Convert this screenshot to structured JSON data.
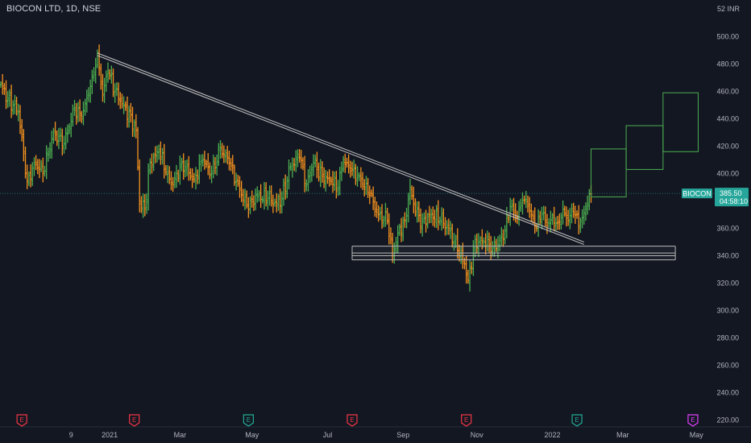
{
  "header": {
    "title": "BIOCON LTD, 1D, NSE",
    "currency": "52 INR"
  },
  "chart_data": {
    "type": "candlestick",
    "symbol": "BIOCON",
    "last_price": "385.50",
    "countdown": "04:58:10",
    "ylim": [
      210,
      530
    ],
    "y_ticks": [
      220,
      240,
      260,
      280,
      300,
      320,
      340,
      360,
      380,
      400,
      420,
      440,
      460,
      480,
      500
    ],
    "x_ticks": [
      {
        "label": "9",
        "idx": 40
      },
      {
        "label": "2021",
        "idx": 62
      },
      {
        "label": "Mar",
        "idx": 102
      },
      {
        "label": "May",
        "idx": 143
      },
      {
        "label": "Jul",
        "idx": 186
      },
      {
        "label": "Sep",
        "idx": 229
      },
      {
        "label": "Nov",
        "idx": 271
      },
      {
        "label": "2022",
        "idx": 314
      },
      {
        "label": "Mar",
        "idx": 354
      },
      {
        "label": "May",
        "idx": 396
      }
    ],
    "earnings_events": [
      {
        "label": "E",
        "idx": 12,
        "color": "#f23645"
      },
      {
        "label": "E",
        "idx": 76,
        "color": "#f23645"
      },
      {
        "label": "E",
        "idx": 141,
        "color": "#22ab94"
      },
      {
        "label": "E",
        "idx": 200,
        "color": "#f23645"
      },
      {
        "label": "E",
        "idx": 265,
        "color": "#f23645"
      },
      {
        "label": "E",
        "idx": 328,
        "color": "#22ab94"
      },
      {
        "label": "E",
        "idx": 394,
        "color": "#e040fb"
      }
    ],
    "anchors": [
      [
        0,
        465
      ],
      [
        4,
        455
      ],
      [
        10,
        445
      ],
      [
        15,
        395
      ],
      [
        20,
        408
      ],
      [
        24,
        400
      ],
      [
        30,
        430
      ],
      [
        36,
        422
      ],
      [
        42,
        448
      ],
      [
        46,
        440
      ],
      [
        52,
        470
      ],
      [
        55,
        488
      ],
      [
        58,
        458
      ],
      [
        61,
        475
      ],
      [
        65,
        460
      ],
      [
        70,
        450
      ],
      [
        77,
        432
      ],
      [
        79,
        378
      ],
      [
        82,
        374
      ],
      [
        85,
        408
      ],
      [
        90,
        416
      ],
      [
        95,
        400
      ],
      [
        98,
        392
      ],
      [
        103,
        408
      ],
      [
        110,
        396
      ],
      [
        115,
        410
      ],
      [
        120,
        400
      ],
      [
        125,
        418
      ],
      [
        130,
        408
      ],
      [
        136,
        388
      ],
      [
        141,
        374
      ],
      [
        145,
        384
      ],
      [
        152,
        382
      ],
      [
        157,
        378
      ],
      [
        160,
        382
      ],
      [
        165,
        405
      ],
      [
        170,
        412
      ],
      [
        174,
        392
      ],
      [
        178,
        408
      ],
      [
        183,
        398
      ],
      [
        188,
        394
      ],
      [
        192,
        390
      ],
      [
        195,
        410
      ],
      [
        199,
        402
      ],
      [
        204,
        398
      ],
      [
        210,
        384
      ],
      [
        215,
        370
      ],
      [
        220,
        366
      ],
      [
        223,
        340
      ],
      [
        226,
        356
      ],
      [
        230,
        366
      ],
      [
        233,
        390
      ],
      [
        236,
        372
      ],
      [
        240,
        365
      ],
      [
        245,
        370
      ],
      [
        250,
        366
      ],
      [
        255,
        360
      ],
      [
        260,
        344
      ],
      [
        264,
        334
      ],
      [
        266,
        322
      ],
      [
        270,
        350
      ],
      [
        275,
        350
      ],
      [
        280,
        347
      ],
      [
        283,
        348
      ],
      [
        287,
        358
      ],
      [
        290,
        376
      ],
      [
        294,
        368
      ],
      [
        297,
        380
      ],
      [
        300,
        376
      ],
      [
        302,
        370
      ],
      [
        305,
        360
      ],
      [
        308,
        370
      ],
      [
        311,
        362
      ],
      [
        314,
        368
      ],
      [
        317,
        364
      ],
      [
        320,
        374
      ],
      [
        323,
        366
      ],
      [
        326,
        372
      ],
      [
        329,
        362
      ],
      [
        331,
        368
      ],
      [
        334,
        378
      ],
      [
        336,
        385
      ]
    ],
    "trendline": {
      "from": [
        55,
        488
      ],
      "to": [
        332,
        350
      ]
    },
    "support_band": {
      "from_idx": 200,
      "to_idx": 384,
      "levels": [
        347,
        342,
        340,
        337
      ]
    },
    "projection_boxes": [
      {
        "x0": 336,
        "x1": 356,
        "low": 383,
        "high": 418
      },
      {
        "x0": 356,
        "x1": 377,
        "low": 403,
        "high": 435
      },
      {
        "x0": 377,
        "x1": 397,
        "low": 416,
        "high": 459
      }
    ],
    "colors": {
      "up": "#4caf50",
      "down": "#f7931e",
      "price_tag": "#26a69a",
      "line": "#b8b8b8"
    }
  }
}
